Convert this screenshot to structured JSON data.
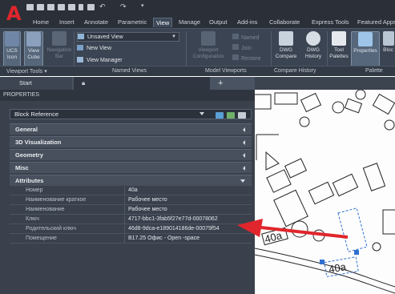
{
  "ribbon": {
    "tabs": [
      "Home",
      "Insert",
      "Annotate",
      "Parametric",
      "View",
      "Manage",
      "Output",
      "Add-ins",
      "Collaborate",
      "Express Tools",
      "Featured Apps"
    ],
    "active_tab": "View",
    "viewport_tools": {
      "ucs_icon": "UCS Icon",
      "view_cube": "View Cube",
      "navigation_bar": "Navigation Bar",
      "group_label": "Viewport Tools ▾"
    },
    "named_views": {
      "current_view": "Unsaved View",
      "new_view": "New View",
      "view_manager": "View Manager",
      "group_label": "Named Views"
    },
    "model_viewports": {
      "viewport_configuration": "Viewport Configuration",
      "named": "Named",
      "join": "Join",
      "restore": "Restore",
      "group_label": "Model Viewports"
    },
    "compare": {
      "dwg_compare": "DWG Compare",
      "dwg_history": "DWG History",
      "group_label": "Compare History"
    },
    "palettes": {
      "tool_palettes": "Tool Palettes",
      "properties": "Properties",
      "blocks": "Bloc",
      "group_label": "Palette"
    }
  },
  "doc_tabs": {
    "start": "Start",
    "plus": "+"
  },
  "properties": {
    "title": "PROPERTIES",
    "object_type": "Block Reference",
    "categories": [
      "General",
      "3D Visualization",
      "Geometry",
      "Misc",
      "Attributes"
    ],
    "attributes": [
      {
        "key": "Номер",
        "value": "40a"
      },
      {
        "key": "Наименование краткое",
        "value": "Рабочее место"
      },
      {
        "key": "Наименование",
        "value": "Рабочее место"
      },
      {
        "key": "Ключ",
        "value": "4717-bbc1-3fab5f27e77d-00078062"
      },
      {
        "key": "Родительский ключ",
        "value": "46d8-9dca-e189014186de-00079f54"
      },
      {
        "key": "Помещение",
        "value": "B17.25 Офис - Open -space"
      }
    ]
  },
  "drawing": {
    "labels": [
      "40a",
      "40a"
    ]
  },
  "colors": {
    "ribbon_bg": "#3b4452",
    "palette_bg": "#3a414d",
    "accent_red": "#e0262c",
    "selection_blue": "#2f6fd0"
  }
}
